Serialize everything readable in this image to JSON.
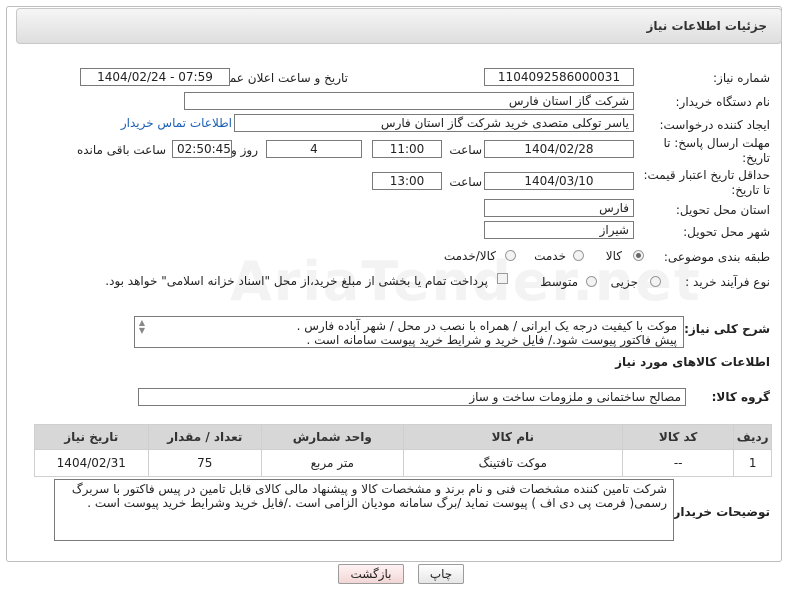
{
  "header": {
    "title": "جزئیات اطلاعات نیاز"
  },
  "fields": {
    "need_number_label": "شماره نیاز:",
    "need_number": "1104092586000031",
    "announce_label": "تاریخ و ساعت اعلان عمومی:",
    "announce_value": "1404/02/24 - 07:59",
    "buyer_org_label": "نام دستگاه خریدار:",
    "buyer_org": "شرکت گاز استان فارس",
    "creator_label": "ایجاد کننده درخواست:",
    "creator": "یاسر توکلی متصدی خرید شرکت گاز استان فارس",
    "contact_link": "اطلاعات تماس خریدار",
    "deadline_label_1": "مهلت ارسال پاسخ: تا",
    "deadline_label_2": "تاریخ:",
    "deadline_date": "1404/02/28",
    "time_label": "ساعت",
    "deadline_time": "11:00",
    "days_value": "4",
    "days_label": "روز و",
    "remaining_value": "02:50:45",
    "remaining_label": "ساعت باقی مانده",
    "price_label_1": "حداقل تاریخ اعتبار قیمت:",
    "price_label_2": "تا تاریخ:",
    "price_date": "1404/03/10",
    "price_time": "13:00",
    "province_label": "استان محل تحویل:",
    "province": "فارس",
    "city_label": "شهر محل تحویل:",
    "city": "شیراز",
    "category_label": "طبقه بندی موضوعی:",
    "category_options": [
      "کالا",
      "خدمت",
      "کالا/خدمت"
    ],
    "process_label": "نوع فرآیند خرید :",
    "process_options": [
      "جزیی",
      "متوسط"
    ],
    "payment_note": "پرداخت تمام یا بخشی از مبلغ خرید،از محل \"اسناد خزانه اسلامی\" خواهد بود."
  },
  "summary": {
    "label": "شرح کلی نیاز:",
    "line1": "موکت با کیفیت درجه یک ایرانی / همراه با نصب در محل  /  شهر آباده فارس .",
    "line2": "پیش فاکتور پیوست شود./ فایل خرید  و شرایط خرید پیوست سامانه است ."
  },
  "goods": {
    "section_title": "اطلاعات کالاهای مورد نیاز",
    "group_label": "گروه کالا:",
    "group_value": "مصالح ساختمانی و ملزومات ساخت و ساز",
    "columns": [
      "ردیف",
      "کد کالا",
      "نام کالا",
      "واحد شمارش",
      "تعداد / مقدار",
      "تاریخ نیاز"
    ],
    "rows": [
      {
        "row": "1",
        "code": "--",
        "name": "موکت تافتینگ",
        "unit": "متر مربع",
        "qty": "75",
        "date": "1404/02/31"
      }
    ]
  },
  "buyer_notes": {
    "label": "توضیحات خریدار:",
    "line1": "شرکت تامین کننده مشخصات فنی و نام برند و مشخصات کالا و پیشنهاد مالی کالای قابل تامین در پیس فاکتور با سربرگ",
    "line2": "رسمی( فرمت پی دی اف ) پیوست نماید /برگ سامانه مودیان الزامی است ./فایل خرید وشرایط خرید پیوست است ."
  },
  "buttons": {
    "print": "چاپ",
    "back": "بازگشت"
  },
  "watermark": "AriaTender.net"
}
